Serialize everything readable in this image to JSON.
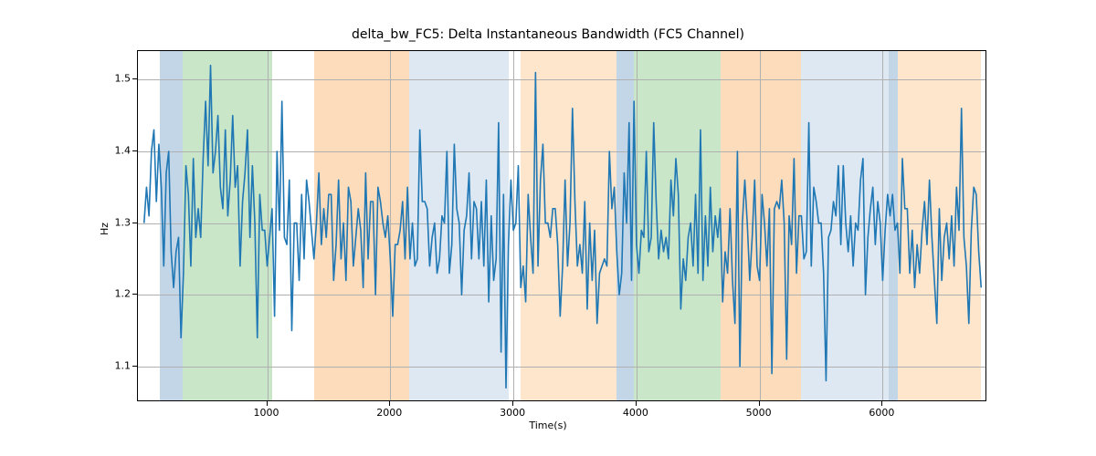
{
  "chart_data": {
    "type": "line",
    "title": "delta_bw_FC5: Delta Instantaneous Bandwidth (FC5 Channel)",
    "xlabel": "Time(s)",
    "ylabel": "Hz",
    "xlim": [
      -50,
      6850
    ],
    "ylim": [
      1.05,
      1.54
    ],
    "x_ticks": [
      1000,
      2000,
      3000,
      4000,
      5000,
      6000
    ],
    "y_ticks": [
      1.1,
      1.2,
      1.3,
      1.4,
      1.5
    ],
    "line_color": "#1f77b4",
    "grid_color": "#b0b0b0",
    "regions": [
      {
        "x0": 130,
        "x1": 310,
        "color": "#c3d6e8"
      },
      {
        "x0": 310,
        "x1": 1040,
        "color": "#c9e6c9"
      },
      {
        "x0": 1380,
        "x1": 2150,
        "color": "#fcdcbb"
      },
      {
        "x0": 2150,
        "x1": 2960,
        "color": "#dde8f2"
      },
      {
        "x0": 3060,
        "x1": 3840,
        "color": "#fde6cc"
      },
      {
        "x0": 3840,
        "x1": 3980,
        "color": "#c3d6e8"
      },
      {
        "x0": 3980,
        "x1": 4680,
        "color": "#c9e6c9"
      },
      {
        "x0": 4680,
        "x1": 5340,
        "color": "#fcdcbb"
      },
      {
        "x0": 5340,
        "x1": 6050,
        "color": "#dde8f2"
      },
      {
        "x0": 6050,
        "x1": 6120,
        "color": "#c3d6e8"
      },
      {
        "x0": 6120,
        "x1": 6800,
        "color": "#fde6cc"
      }
    ],
    "x": [
      0,
      20,
      40,
      60,
      80,
      100,
      120,
      140,
      160,
      180,
      200,
      220,
      240,
      260,
      280,
      300,
      320,
      340,
      360,
      380,
      400,
      420,
      440,
      460,
      480,
      500,
      520,
      540,
      560,
      580,
      600,
      620,
      640,
      660,
      680,
      700,
      720,
      740,
      760,
      780,
      800,
      820,
      840,
      860,
      880,
      900,
      920,
      940,
      960,
      980,
      1000,
      1020,
      1040,
      1060,
      1080,
      1100,
      1120,
      1140,
      1160,
      1180,
      1200,
      1220,
      1240,
      1260,
      1280,
      1300,
      1320,
      1340,
      1360,
      1380,
      1400,
      1420,
      1440,
      1460,
      1480,
      1500,
      1520,
      1540,
      1560,
      1580,
      1600,
      1620,
      1640,
      1660,
      1680,
      1700,
      1720,
      1740,
      1760,
      1780,
      1800,
      1820,
      1840,
      1860,
      1880,
      1900,
      1920,
      1940,
      1960,
      1980,
      2000,
      2020,
      2040,
      2060,
      2080,
      2100,
      2120,
      2140,
      2160,
      2180,
      2200,
      2220,
      2240,
      2260,
      2280,
      2300,
      2320,
      2340,
      2360,
      2380,
      2400,
      2420,
      2440,
      2460,
      2480,
      2500,
      2520,
      2540,
      2560,
      2580,
      2600,
      2620,
      2640,
      2660,
      2680,
      2700,
      2720,
      2740,
      2760,
      2780,
      2800,
      2820,
      2840,
      2860,
      2880,
      2900,
      2920,
      2940,
      2960,
      2980,
      3000,
      3020,
      3040,
      3060,
      3080,
      3100,
      3120,
      3140,
      3160,
      3180,
      3200,
      3220,
      3240,
      3260,
      3280,
      3300,
      3320,
      3340,
      3360,
      3380,
      3400,
      3420,
      3440,
      3460,
      3480,
      3500,
      3520,
      3540,
      3560,
      3580,
      3600,
      3620,
      3640,
      3660,
      3680,
      3700,
      3720,
      3740,
      3760,
      3780,
      3800,
      3820,
      3840,
      3860,
      3880,
      3900,
      3920,
      3940,
      3960,
      3980,
      4000,
      4020,
      4040,
      4060,
      4080,
      4100,
      4120,
      4140,
      4160,
      4180,
      4200,
      4220,
      4240,
      4260,
      4280,
      4300,
      4320,
      4340,
      4360,
      4380,
      4400,
      4420,
      4440,
      4460,
      4480,
      4500,
      4520,
      4540,
      4560,
      4580,
      4600,
      4620,
      4640,
      4660,
      4680,
      4700,
      4720,
      4740,
      4760,
      4780,
      4800,
      4820,
      4840,
      4860,
      4880,
      4900,
      4920,
      4940,
      4960,
      4980,
      5000,
      5020,
      5040,
      5060,
      5080,
      5100,
      5120,
      5140,
      5160,
      5180,
      5200,
      5220,
      5240,
      5260,
      5280,
      5300,
      5320,
      5340,
      5360,
      5380,
      5400,
      5420,
      5440,
      5460,
      5480,
      5500,
      5520,
      5540,
      5560,
      5580,
      5600,
      5620,
      5640,
      5660,
      5680,
      5700,
      5720,
      5740,
      5760,
      5780,
      5800,
      5820,
      5840,
      5860,
      5880,
      5900,
      5920,
      5940,
      5960,
      5980,
      6000,
      6020,
      6040,
      6060,
      6080,
      6100,
      6120,
      6140,
      6160,
      6180,
      6200,
      6220,
      6240,
      6260,
      6280,
      6300,
      6320,
      6340,
      6360,
      6380,
      6400,
      6420,
      6440,
      6460,
      6480,
      6500,
      6520,
      6540,
      6560,
      6580,
      6600,
      6620,
      6640,
      6660,
      6680,
      6700,
      6720,
      6740,
      6760,
      6780,
      6800
    ],
    "values": [
      1.3,
      1.35,
      1.31,
      1.4,
      1.43,
      1.33,
      1.41,
      1.35,
      1.24,
      1.37,
      1.4,
      1.26,
      1.21,
      1.26,
      1.28,
      1.14,
      1.23,
      1.38,
      1.34,
      1.24,
      1.39,
      1.28,
      1.32,
      1.28,
      1.39,
      1.47,
      1.38,
      1.52,
      1.37,
      1.4,
      1.45,
      1.35,
      1.32,
      1.43,
      1.31,
      1.36,
      1.45,
      1.35,
      1.38,
      1.24,
      1.33,
      1.37,
      1.43,
      1.28,
      1.38,
      1.3,
      1.14,
      1.34,
      1.29,
      1.29,
      1.24,
      1.28,
      1.32,
      1.17,
      1.4,
      1.29,
      1.47,
      1.28,
      1.27,
      1.36,
      1.15,
      1.3,
      1.3,
      1.22,
      1.34,
      1.25,
      1.36,
      1.33,
      1.29,
      1.25,
      1.3,
      1.37,
      1.27,
      1.32,
      1.28,
      1.34,
      1.34,
      1.22,
      1.27,
      1.36,
      1.25,
      1.3,
      1.22,
      1.35,
      1.33,
      1.24,
      1.28,
      1.32,
      1.29,
      1.21,
      1.37,
      1.25,
      1.33,
      1.33,
      1.2,
      1.35,
      1.33,
      1.3,
      1.28,
      1.31,
      1.25,
      1.17,
      1.27,
      1.27,
      1.29,
      1.33,
      1.25,
      1.35,
      1.25,
      1.3,
      1.24,
      1.25,
      1.43,
      1.33,
      1.33,
      1.32,
      1.24,
      1.28,
      1.3,
      1.23,
      1.25,
      1.31,
      1.3,
      1.4,
      1.23,
      1.27,
      1.41,
      1.32,
      1.3,
      1.2,
      1.29,
      1.31,
      1.37,
      1.25,
      1.33,
      1.32,
      1.25,
      1.33,
      1.24,
      1.36,
      1.19,
      1.31,
      1.22,
      1.25,
      1.44,
      1.12,
      1.34,
      1.07,
      1.27,
      1.36,
      1.29,
      1.3,
      1.38,
      1.21,
      1.24,
      1.19,
      1.34,
      1.28,
      1.23,
      1.51,
      1.24,
      1.36,
      1.41,
      1.3,
      1.3,
      1.28,
      1.32,
      1.32,
      1.27,
      1.17,
      1.24,
      1.36,
      1.24,
      1.3,
      1.46,
      1.33,
      1.24,
      1.27,
      1.23,
      1.33,
      1.18,
      1.3,
      1.22,
      1.29,
      1.16,
      1.23,
      1.24,
      1.25,
      1.24,
      1.4,
      1.32,
      1.35,
      1.26,
      1.2,
      1.23,
      1.37,
      1.3,
      1.44,
      1.22,
      1.47,
      1.27,
      1.23,
      1.29,
      1.28,
      1.4,
      1.26,
      1.28,
      1.44,
      1.33,
      1.25,
      1.29,
      1.26,
      1.28,
      1.25,
      1.36,
      1.31,
      1.39,
      1.34,
      1.18,
      1.25,
      1.22,
      1.28,
      1.3,
      1.24,
      1.34,
      1.23,
      1.43,
      1.22,
      1.31,
      1.24,
      1.35,
      1.26,
      1.31,
      1.28,
      1.32,
      1.19,
      1.26,
      1.23,
      1.32,
      1.22,
      1.16,
      1.4,
      1.1,
      1.3,
      1.36,
      1.3,
      1.22,
      1.28,
      1.36,
      1.24,
      1.22,
      1.34,
      1.3,
      1.24,
      1.32,
      1.09,
      1.32,
      1.33,
      1.32,
      1.36,
      1.3,
      1.11,
      1.31,
      1.27,
      1.39,
      1.23,
      1.31,
      1.31,
      1.25,
      1.26,
      1.44,
      1.24,
      1.35,
      1.33,
      1.3,
      1.3,
      1.23,
      1.08,
      1.28,
      1.29,
      1.33,
      1.31,
      1.38,
      1.27,
      1.38,
      1.3,
      1.26,
      1.31,
      1.24,
      1.3,
      1.29,
      1.36,
      1.39,
      1.2,
      1.28,
      1.32,
      1.35,
      1.27,
      1.33,
      1.3,
      1.22,
      1.29,
      1.34,
      1.31,
      1.34,
      1.29,
      1.3,
      1.23,
      1.39,
      1.32,
      1.32,
      1.23,
      1.29,
      1.21,
      1.27,
      1.23,
      1.29,
      1.33,
      1.27,
      1.36,
      1.28,
      1.22,
      1.16,
      1.32,
      1.22,
      1.28,
      1.3,
      1.25,
      1.31,
      1.24,
      1.35,
      1.29,
      1.46,
      1.28,
      1.24,
      1.16,
      1.29,
      1.35,
      1.34,
      1.26,
      1.21
    ]
  },
  "layout": {
    "fig_w": 1200,
    "fig_h": 500,
    "ax_left": 150,
    "ax_top": 55,
    "ax_w": 930,
    "ax_h": 385
  }
}
